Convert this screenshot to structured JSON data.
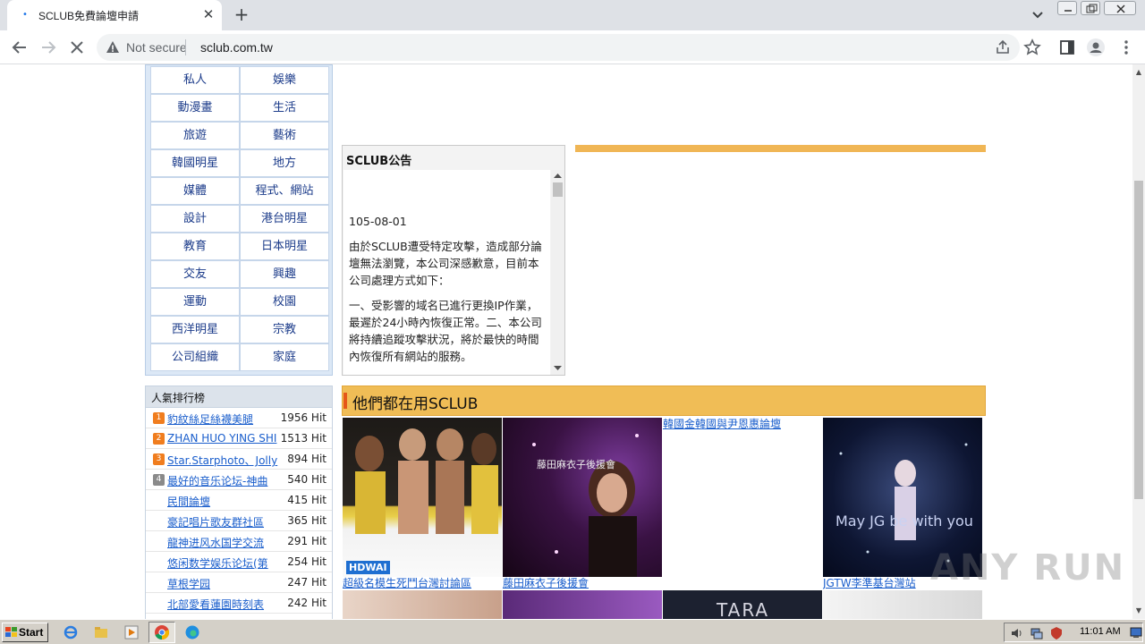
{
  "browser": {
    "tab_title": "SCLUB免費論壇申請",
    "security_label": "Not secure",
    "url": "sclub.com.tw"
  },
  "categories": [
    "私人",
    "娛樂",
    "動漫畫",
    "生活",
    "旅遊",
    "藝術",
    "韓國明星",
    "地方",
    "媒體",
    "程式、網站",
    "設計",
    "港台明星",
    "教育",
    "日本明星",
    "交友",
    "興趣",
    "運動",
    "校園",
    "西洋明星",
    "宗教",
    "公司組織",
    "家庭"
  ],
  "notice": {
    "title": "SCLUB公告",
    "date": "105-08-01",
    "paragraphs": [
      "由於SCLUB遭受特定攻擊，造成部分論壇無法瀏覽，本公司深感歉意，目前本公司處理方式如下：",
      "一、受影響的域名已進行更換IP作業，最遲於24小時內恢復正常。二、本公司將持續追蹤攻擊狀況，將於最快的時間內恢復所有網站的服務。"
    ]
  },
  "ranking": {
    "title": "人氣排行榜",
    "rows": [
      {
        "badge": "1",
        "name": "豹紋絲足絲襪美腿",
        "hits": "1956 Hit"
      },
      {
        "badge": "2",
        "name": "ZHAN HUO YING SHI",
        "hits": "1513 Hit"
      },
      {
        "badge": "3",
        "name": "Star.Starphoto、Jolly",
        "hits": "894 Hit"
      },
      {
        "badge": "4",
        "name": "最好的音乐论坛-神曲",
        "hits": "540 Hit"
      },
      {
        "badge": "",
        "name": "民間論壇",
        "hits": "415 Hit"
      },
      {
        "badge": "",
        "name": "豪記唱片歌友群社區",
        "hits": "365 Hit"
      },
      {
        "badge": "",
        "name": "龍神进风水国学交流",
        "hits": "291 Hit"
      },
      {
        "badge": "",
        "name": "悠闲数学娱乐论坛(第",
        "hits": "254 Hit"
      },
      {
        "badge": "",
        "name": "草根学园",
        "hits": "247 Hit"
      },
      {
        "badge": "",
        "name": "北部愛看蓮園時刻表",
        "hits": "242 Hit"
      }
    ]
  },
  "users_section": {
    "title": "他們都在用SCLUB",
    "items": [
      {
        "caption": "超級名模生死鬥台灣討論區",
        "img_text": "HDWAI"
      },
      {
        "caption": "藤田麻衣子後援會",
        "img_text": "藤田麻衣子後援會"
      },
      {
        "caption": "韓國金韓國與尹恩惠論壇",
        "img_text": ""
      },
      {
        "caption": "JGTW李準基台灣站",
        "img_text": "May JG   be with you"
      }
    ],
    "row2_text": "TARA"
  },
  "watermark": "ANY RUN",
  "taskbar": {
    "start_label": "Start",
    "clock": "11:01 AM"
  },
  "colors": {
    "accent_orange": "#f0bd56",
    "link_blue": "#1a5ecc",
    "category_blue": "#1b3b8a"
  }
}
